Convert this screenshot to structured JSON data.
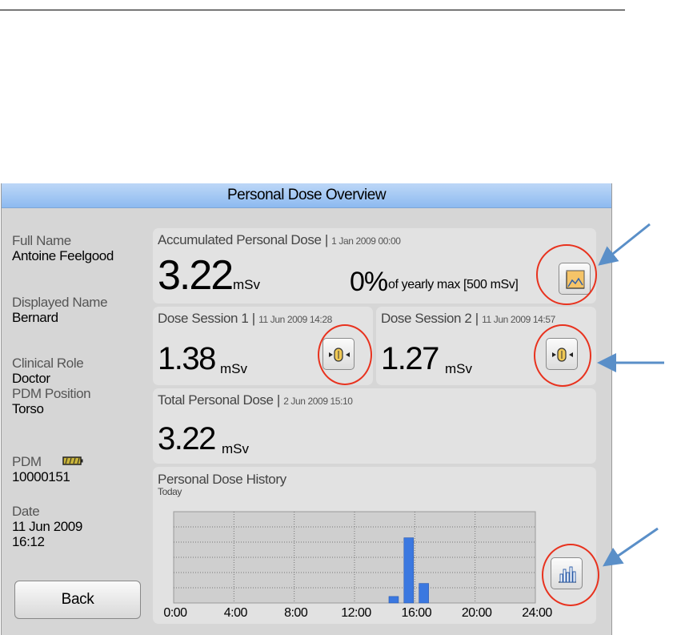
{
  "window": {
    "title": "Personal Dose Overview"
  },
  "sidebar": {
    "full_name_label": "Full Name",
    "full_name": "Antoine Feelgood",
    "displayed_name_label": "Displayed Name",
    "displayed_name": "Bernard",
    "clinical_role_label": "Clinical Role",
    "clinical_role": "Doctor",
    "pdm_position_label": "PDM Position",
    "pdm_position": "Torso",
    "pdm_label": "PDM",
    "pdm_id": "10000151",
    "date_label": "Date",
    "date": "11 Jun 2009",
    "time": "16:12",
    "back_label": "Back"
  },
  "accumulated": {
    "title": "Accumulated Personal Dose |",
    "date": "1 Jan 2009 00:00",
    "value": "3.22",
    "unit": "mSv",
    "percent": "0%",
    "percent_text": "of yearly max [500 mSv]"
  },
  "session1": {
    "title": "Dose Session 1 |",
    "date": "11 Jun 2009 14:28",
    "value": "1.38",
    "unit": "mSv"
  },
  "session2": {
    "title": "Dose Session 2 |",
    "date": "11 Jun 2009 14:57",
    "value": "1.27",
    "unit": "mSv"
  },
  "total": {
    "title": "Total Personal Dose |",
    "date": "2 Jun 2009 15:10",
    "value": "3.22",
    "unit": "mSv"
  },
  "history": {
    "title": "Personal Dose History",
    "subtitle": "Today"
  },
  "chart_data": {
    "type": "bar",
    "x_ticks": [
      "0:00",
      "4:00",
      "8:00",
      "12:00",
      "16:00",
      "20:00",
      "24:00"
    ],
    "x_range": [
      0,
      24
    ],
    "bars": [
      {
        "x": 14.6,
        "value": 0.1
      },
      {
        "x": 15.6,
        "value": 1.0
      },
      {
        "x": 16.6,
        "value": 0.3
      }
    ],
    "ylim": [
      0,
      1.4
    ],
    "grid": true,
    "bar_color": "#3b78e0"
  },
  "colors": {
    "titlebar": "#a9cbf5",
    "panel": "#e2e2e2",
    "background": "#d6d6d6",
    "highlight_ring": "#e8321e",
    "callout_arrow": "#5a8fc8"
  },
  "icons": {
    "graph_button": "area-chart-icon",
    "session_button": "dosimeter-icon",
    "history_button": "bar-chart-icon",
    "battery": "battery-icon"
  }
}
